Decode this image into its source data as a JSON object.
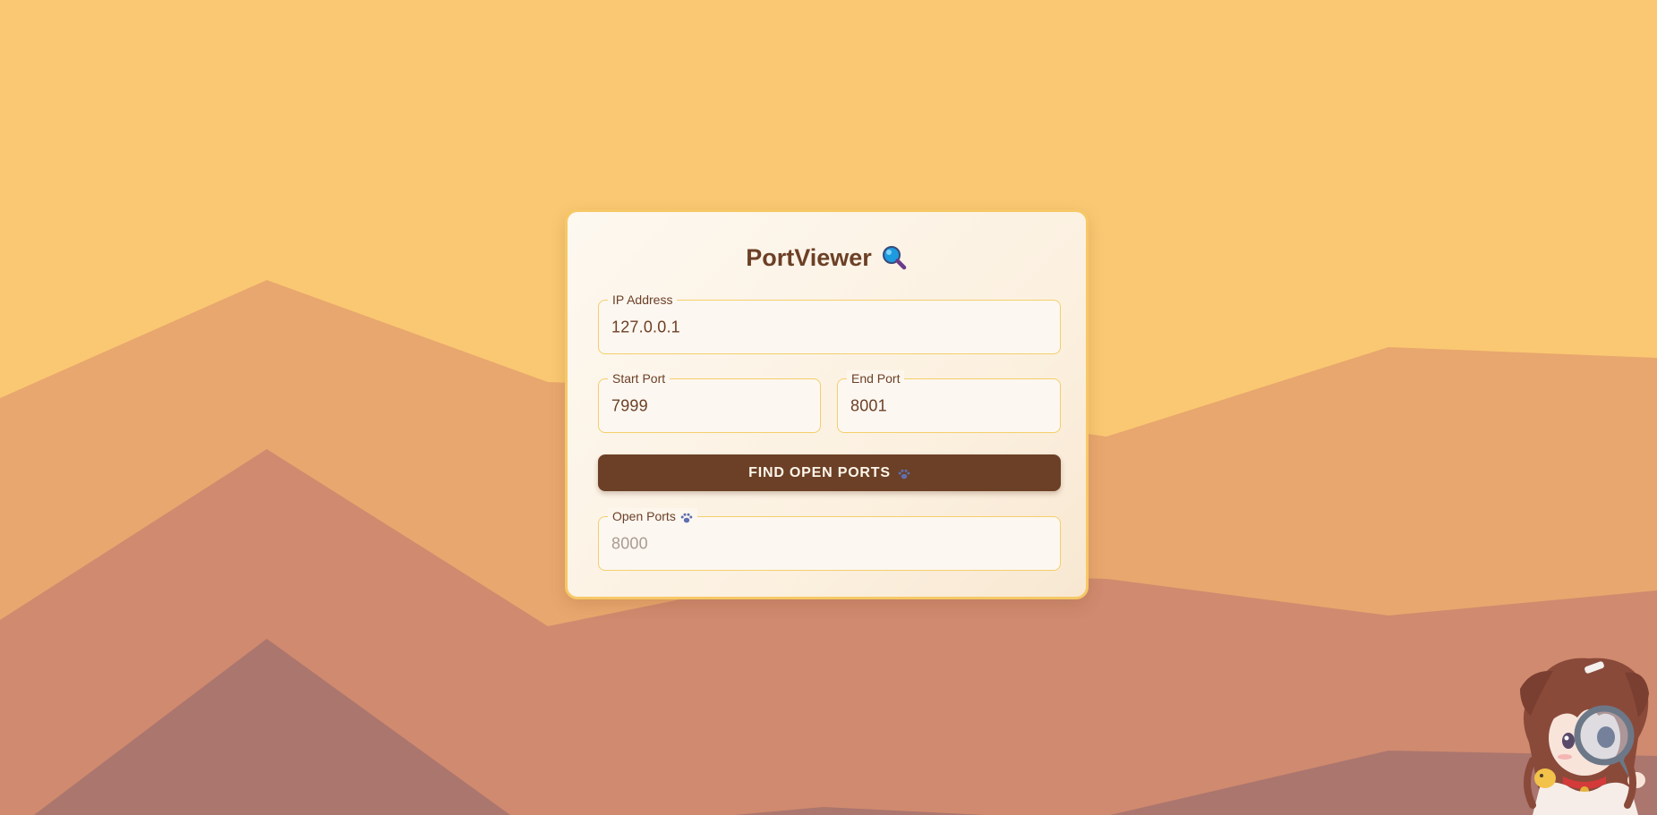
{
  "app": {
    "title": "PortViewer",
    "title_icon": "magnifier-icon"
  },
  "form": {
    "ip": {
      "label": "IP Address",
      "value": "127.0.0.1"
    },
    "start_port": {
      "label": "Start Port",
      "value": "7999"
    },
    "end_port": {
      "label": "End Port",
      "value": "8001"
    },
    "submit_label": "FIND OPEN PORTS",
    "submit_icon": "paw-icon"
  },
  "results": {
    "label": "Open Ports",
    "label_icon": "paw-icon",
    "value": "8000"
  },
  "colors": {
    "sky": "#fac872",
    "accent_brown": "#6c4026",
    "border_gold": "#f6c866",
    "mountain_1": "#e8a76e",
    "mountain_2": "#d08a6f",
    "mountain_3": "#ab766e"
  }
}
